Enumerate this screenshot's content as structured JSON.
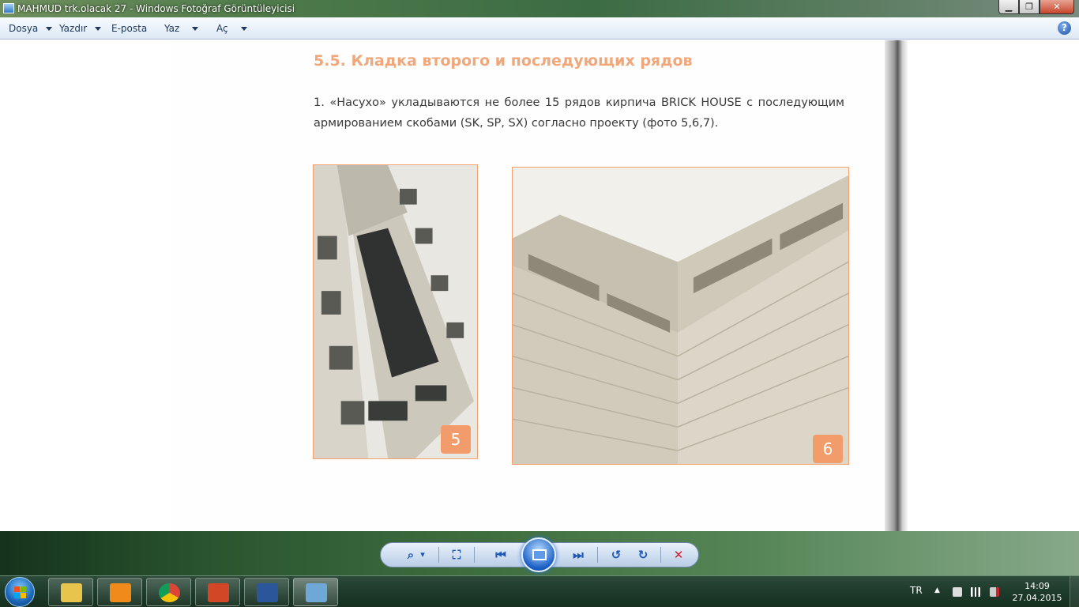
{
  "window": {
    "title": "MAHMUD trk.olacak 27 - Windows Fotoğraf Görüntüleyicisi",
    "minimize_label": "▁",
    "maximize_label": "❐",
    "close_label": "✕"
  },
  "menu": {
    "items": [
      {
        "label": "Dosya"
      },
      {
        "label": "Yazdır"
      },
      {
        "label": "E-posta"
      },
      {
        "label": "Yaz"
      },
      {
        "label": "Aç"
      }
    ],
    "help_label": "?"
  },
  "document": {
    "heading": "5.5. Кладка второго и последующих рядов",
    "paragraph": "1. «Насухо» укладываются не более 15 рядов кирпича BRICK HOUSE с последующим армированием скобами (SK, SP, SX) согласно проекту (фото 5,6,7).",
    "photos": [
      {
        "badge": "5"
      },
      {
        "badge": "6"
      }
    ]
  },
  "controls": {
    "zoom_icon": "⌕",
    "zoom_caret": "▾",
    "fit_icon": "⛶",
    "previous_icon": "⏮",
    "next_icon": "⏭",
    "rotate_left_icon": "↺",
    "rotate_right_icon": "↻",
    "delete_icon": "✕"
  },
  "taskbar": {
    "language": "TR",
    "tray_expand": "▲",
    "time": "14:09",
    "date": "27.04.2015",
    "apps": [
      {
        "name": "explorer",
        "color": "#e8c44c"
      },
      {
        "name": "media-player",
        "color": "#f08a1a"
      },
      {
        "name": "chrome",
        "color": "#3b8f3b"
      },
      {
        "name": "powerpoint",
        "color": "#d24726"
      },
      {
        "name": "word",
        "color": "#2b579a"
      },
      {
        "name": "photo-viewer",
        "color": "#6fa7d6"
      }
    ]
  }
}
